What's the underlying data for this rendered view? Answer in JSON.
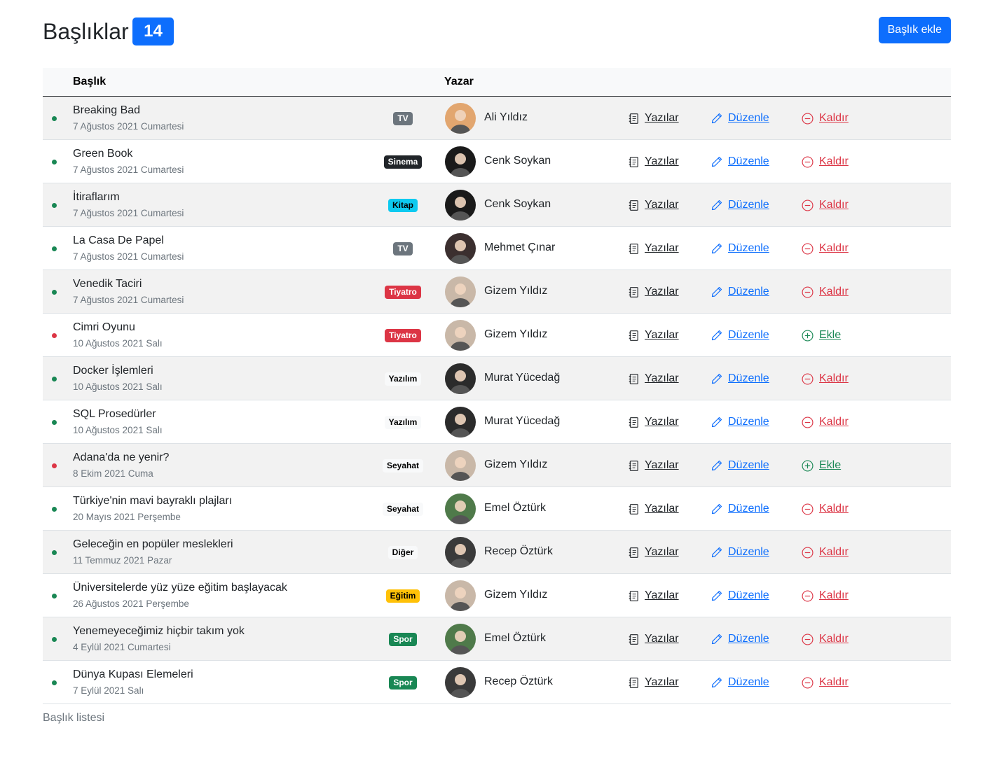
{
  "header": {
    "title": "Başlıklar",
    "count": "14",
    "add_button_label": "Başlık ekle"
  },
  "table": {
    "columns": [
      "Başlık",
      "Yazar"
    ],
    "caption": "Başlık listesi",
    "actions": {
      "posts_label": "Yazılar",
      "edit_label": "Düzenle",
      "remove_label": "Kaldır",
      "add_label": "Ekle"
    },
    "status_colors": {
      "active": "#198754",
      "passive": "#dc3545"
    },
    "categories": {
      "TV": {
        "bg": "#6c757d",
        "fg": "#ffffff"
      },
      "Sinema": {
        "bg": "#212529",
        "fg": "#ffffff"
      },
      "Kitap": {
        "bg": "#0dcaf0",
        "fg": "#000000"
      },
      "Tiyatro": {
        "bg": "#dc3545",
        "fg": "#ffffff"
      },
      "Yazılım": {
        "bg": "#f8f9fa",
        "fg": "#000000"
      },
      "Seyahat": {
        "bg": "#f8f9fa",
        "fg": "#000000"
      },
      "Diğer": {
        "bg": "#f8f9fa",
        "fg": "#000000"
      },
      "Eğitim": {
        "bg": "#ffc107",
        "fg": "#000000"
      },
      "Spor": {
        "bg": "#198754",
        "fg": "#ffffff"
      }
    },
    "rows": [
      {
        "title": "Breaking Bad",
        "date": "7 Ağustos 2021 Cumartesi",
        "category": "TV",
        "author": "Ali Yıldız",
        "status": "active",
        "avatar_color": "#e2a66f"
      },
      {
        "title": "Green Book",
        "date": "7 Ağustos 2021 Cumartesi",
        "category": "Sinema",
        "author": "Cenk Soykan",
        "status": "active",
        "avatar_color": "#1a1a1a"
      },
      {
        "title": "İtiraflarım",
        "date": "7 Ağustos 2021 Cumartesi",
        "category": "Kitap",
        "author": "Cenk Soykan",
        "status": "active",
        "avatar_color": "#1a1a1a"
      },
      {
        "title": "La Casa De Papel",
        "date": "7 Ağustos 2021 Cumartesi",
        "category": "TV",
        "author": "Mehmet Çınar",
        "status": "active",
        "avatar_color": "#3b2f2f"
      },
      {
        "title": "Venedik Taciri",
        "date": "7 Ağustos 2021 Cumartesi",
        "category": "Tiyatro",
        "author": "Gizem Yıldız",
        "status": "active",
        "avatar_color": "#c9b8a8"
      },
      {
        "title": "Cimri Oyunu",
        "date": "10 Ağustos 2021 Salı",
        "category": "Tiyatro",
        "author": "Gizem Yıldız",
        "status": "passive",
        "avatar_color": "#c9b8a8"
      },
      {
        "title": "Docker İşlemleri",
        "date": "10 Ağustos 2021 Salı",
        "category": "Yazılım",
        "author": "Murat Yücedağ",
        "status": "active",
        "avatar_color": "#2b2b2b"
      },
      {
        "title": "SQL Prosedürler",
        "date": "10 Ağustos 2021 Salı",
        "category": "Yazılım",
        "author": "Murat Yücedağ",
        "status": "active",
        "avatar_color": "#2b2b2b"
      },
      {
        "title": "Adana'da ne yenir?",
        "date": "8 Ekim 2021 Cuma",
        "category": "Seyahat",
        "author": "Gizem Yıldız",
        "status": "passive",
        "avatar_color": "#c9b8a8"
      },
      {
        "title": "Türkiye'nin mavi bayraklı plajları",
        "date": "20 Mayıs 2021 Perşembe",
        "category": "Seyahat",
        "author": "Emel Öztürk",
        "status": "active",
        "avatar_color": "#4f7a4a"
      },
      {
        "title": "Geleceğin en popüler meslekleri",
        "date": "11 Temmuz 2021 Pazar",
        "category": "Diğer",
        "author": "Recep Öztürk",
        "status": "active",
        "avatar_color": "#3a3a3a"
      },
      {
        "title": "Üniversitelerde yüz yüze eğitim başlayacak",
        "date": "26 Ağustos 2021 Perşembe",
        "category": "Eğitim",
        "author": "Gizem Yıldız",
        "status": "active",
        "avatar_color": "#c9b8a8"
      },
      {
        "title": "Yenemeyeceğimiz hiçbir takım yok",
        "date": "4 Eylül 2021 Cumartesi",
        "category": "Spor",
        "author": "Emel Öztürk",
        "status": "active",
        "avatar_color": "#4f7a4a"
      },
      {
        "title": "Dünya Kupası Elemeleri",
        "date": "7 Eylül 2021 Salı",
        "category": "Spor",
        "author": "Recep Öztürk",
        "status": "active",
        "avatar_color": "#3a3a3a"
      }
    ]
  }
}
